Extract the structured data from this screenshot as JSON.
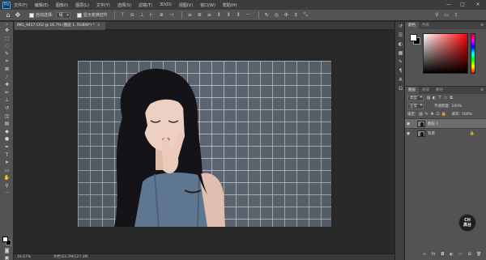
{
  "app": {
    "logo": "Ps"
  },
  "menu": [
    "文件(F)",
    "编辑(E)",
    "图像(I)",
    "图层(L)",
    "文字(Y)",
    "选择(S)",
    "滤镜(T)",
    "3D(D)",
    "视图(V)",
    "窗口(W)",
    "帮助(H)"
  ],
  "window_controls": {
    "minimize": "—",
    "maximize": "□",
    "close": "✕"
  },
  "options": {
    "auto_select_label": "自动选择:",
    "auto_select_value": "组",
    "show_transform_label": "显示变换控件"
  },
  "document": {
    "tab_title": "IMG_9417.CR2 @ 16.7% (图层 1, RGB/8*) *",
    "tab_close": "×"
  },
  "status": {
    "zoom": "16.67%",
    "doc_size": "文档:63.7M/127.3M"
  },
  "color_panel": {
    "tabs": [
      "颜色",
      "色板"
    ]
  },
  "layers_panel": {
    "tabs": [
      "图层",
      "通道",
      "路径"
    ],
    "filter_kind": "类型",
    "blend_mode": "正常",
    "opacity_label": "不透明度:",
    "opacity_value": "100%",
    "lock_label": "锁定:",
    "fill_label": "填充:",
    "fill_value": "100%",
    "layers": [
      {
        "name": "图层 1",
        "selected": true,
        "locked": false
      },
      {
        "name": "背景",
        "selected": false,
        "locked": true
      }
    ]
  },
  "watermark": {
    "line1": "CH",
    "line2": "高台"
  },
  "colors": {
    "foreground": "#ffffff",
    "background": "#000000",
    "accent": "#31a8ff"
  }
}
